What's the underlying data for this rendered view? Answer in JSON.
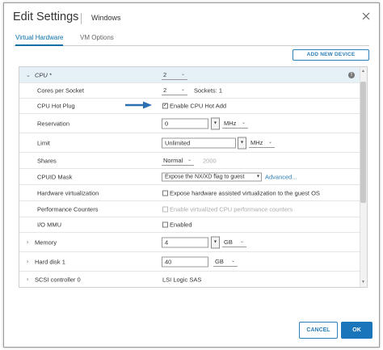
{
  "dialog": {
    "title": "Edit Settings",
    "subtitle": "Windows",
    "close_icon": "close-icon"
  },
  "tabs": [
    {
      "label": "Virtual Hardware",
      "active": true
    },
    {
      "label": "VM Options",
      "active": false
    }
  ],
  "add_device_label": "ADD NEW DEVICE",
  "cpu": {
    "label": "CPU *",
    "value": "2",
    "cores_label": "Cores per Socket",
    "cores_value": "2",
    "sockets_text": "Sockets: 1",
    "hotplug_label": "CPU Hot Plug",
    "hotplug_option": "Enable CPU Hot Add",
    "hotplug_checked": true,
    "reservation_label": "Reservation",
    "reservation_value": "0",
    "reservation_unit": "MHz",
    "limit_label": "Limit",
    "limit_value": "Unlimited",
    "limit_unit": "MHz",
    "shares_label": "Shares",
    "shares_value": "Normal",
    "shares_number": "2000",
    "cpuid_label": "CPUID Mask",
    "cpuid_value": "Expose the NX/XD flag to guest",
    "cpuid_link": "Advanced...",
    "hwvirt_label": "Hardware virtualization",
    "hwvirt_option": "Expose hardware assisted virtualization to the guest OS",
    "perf_label": "Performance Counters",
    "perf_option": "Enable virtualized CPU performance counters",
    "iommu_label": "I/O MMU",
    "iommu_option": "Enabled"
  },
  "memory": {
    "label": "Memory",
    "value": "4",
    "unit": "GB"
  },
  "harddisk": {
    "label": "Hard disk 1",
    "value": "40",
    "unit": "GB"
  },
  "scsi": {
    "label": "SCSI controller 0",
    "value": "LSI Logic SAS"
  },
  "buttons": {
    "cancel": "CANCEL",
    "ok": "OK"
  },
  "colors": {
    "accent": "#1b75bb",
    "cpu_row_bg": "#e5f0f7",
    "arrow": "#2a6fb0"
  }
}
